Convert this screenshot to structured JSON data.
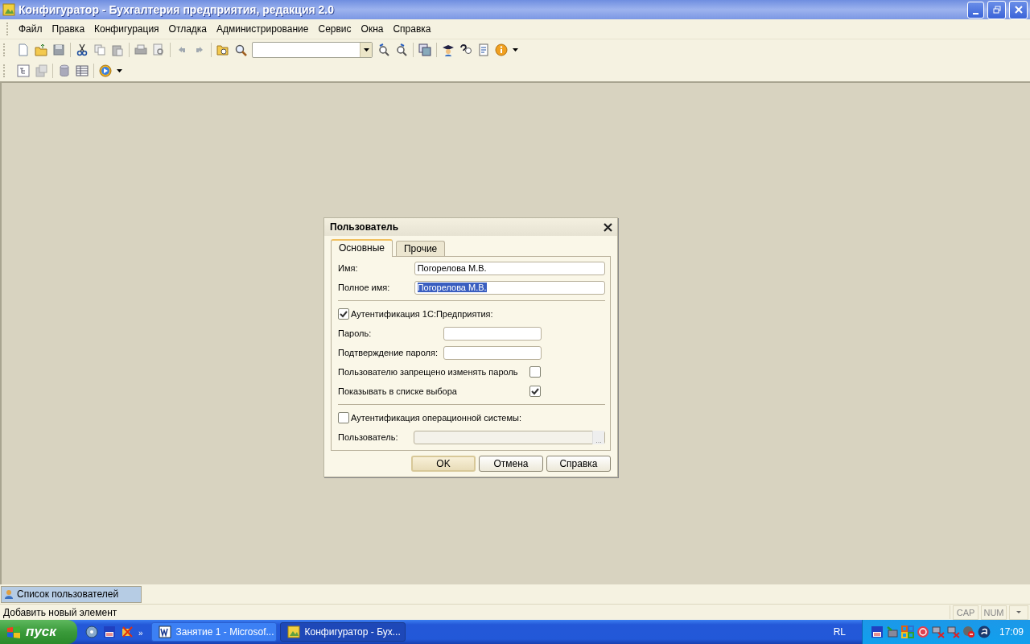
{
  "window": {
    "title": "Конфигуратор - Бухгалтерия предприятия, редакция 2.0"
  },
  "menu": [
    {
      "label": "Файл"
    },
    {
      "label": "Правка"
    },
    {
      "label": "Конфигурация"
    },
    {
      "label": "Отладка"
    },
    {
      "label": "Администрирование"
    },
    {
      "label": "Сервис"
    },
    {
      "label": "Окна"
    },
    {
      "label": "Справка"
    }
  ],
  "dialog": {
    "title": "Пользователь",
    "tabs": [
      {
        "label": "Основные",
        "selected": true
      },
      {
        "label": "Прочие",
        "selected": false
      }
    ],
    "name_fields": [
      {
        "label": "Имя:",
        "value": "Погорелова М.В.",
        "text_selected": false
      },
      {
        "label": "Полное имя:",
        "value": "Погорелова М.В.",
        "text_selected": true
      }
    ],
    "auth_1c": {
      "label": "Аутентификация 1С:Предприятия:",
      "checked": true
    },
    "password_fields": [
      {
        "label": "Пароль:"
      },
      {
        "label": "Подтверждение пароля:"
      }
    ],
    "options": [
      {
        "label": "Пользователю запрещено изменять пароль",
        "checked": false
      },
      {
        "label": "Показывать в списке выбора",
        "checked": true
      }
    ],
    "auth_os": {
      "label": "Аутентификация операционной системы:",
      "checked": false
    },
    "os_user": {
      "label": "Пользователь:",
      "disabled": true,
      "choose_button": "..."
    },
    "buttons": [
      {
        "label": "OK",
        "default": true
      },
      {
        "label": "Отмена",
        "default": false
      },
      {
        "label": "Справка",
        "default": false
      }
    ]
  },
  "window_bar": {
    "items": [
      {
        "label": "Список пользователей",
        "selected": true
      }
    ]
  },
  "status_bar": {
    "text": "Добавить новый элемент",
    "indicators": [
      "CAP",
      "NUM"
    ]
  },
  "taskbar": {
    "start": "пуск",
    "quick_launch_more": "»",
    "tasks": [
      {
        "label": "Занятие 1 - Microsof...",
        "selected": false
      },
      {
        "label": "Конфигуратор - Бух...",
        "selected": true
      }
    ],
    "language": "RL",
    "clock": "17:09"
  }
}
